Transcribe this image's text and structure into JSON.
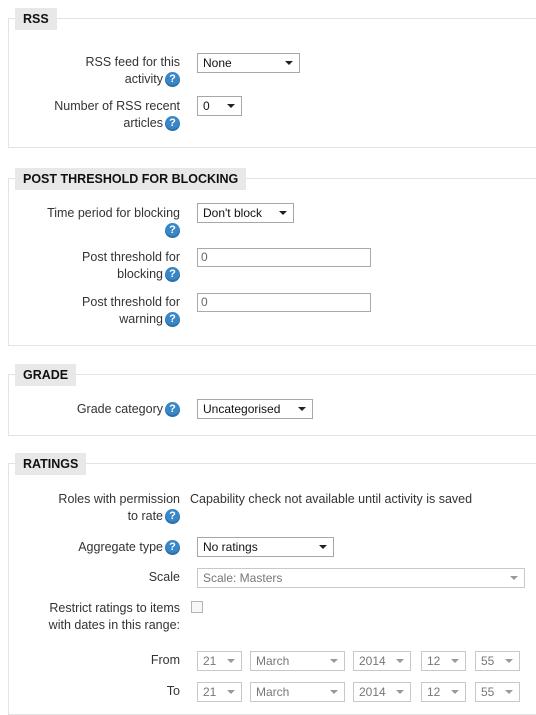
{
  "rss": {
    "legend": "RSS",
    "feed": {
      "label_1": "RSS feed for this",
      "label_2": "activity",
      "value": "None"
    },
    "articles": {
      "label_1": "Number of RSS recent",
      "label_2": "articles",
      "value": "0"
    }
  },
  "blocking": {
    "legend": "POST THRESHOLD FOR BLOCKING",
    "period": {
      "label_1": "Time period for blocking",
      "value": "Don't block"
    },
    "threshold": {
      "label_1": "Post threshold for",
      "label_2": "blocking",
      "value": "0"
    },
    "warning": {
      "label_1": "Post threshold for",
      "label_2": "warning",
      "value": "0"
    }
  },
  "grade": {
    "legend": "GRADE",
    "category": {
      "label": "Grade category",
      "value": "Uncategorised"
    }
  },
  "ratings": {
    "legend": "RATINGS",
    "roles": {
      "label_1": "Roles with permission",
      "label_2": "to rate",
      "value": "Capability check not available until activity is saved"
    },
    "aggregate": {
      "label": "Aggregate type",
      "value": "No ratings"
    },
    "scale": {
      "label": "Scale",
      "value": "Scale: Masters"
    },
    "restrict": {
      "label_1": "Restrict ratings to items",
      "label_2": "with dates in this range:"
    },
    "from": {
      "label": "From",
      "day": "21",
      "month": "March",
      "year": "2014",
      "hour": "12",
      "minute": "55"
    },
    "to": {
      "label": "To",
      "day": "21",
      "month": "March",
      "year": "2014",
      "hour": "12",
      "minute": "55"
    }
  },
  "icons": {
    "help": "help-icon",
    "help_glyph": "?",
    "help_color": "#3a87c8"
  }
}
